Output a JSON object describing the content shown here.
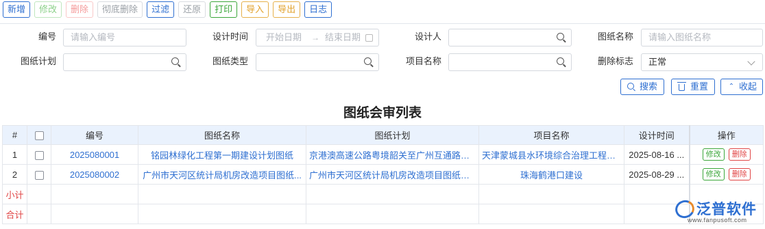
{
  "toolbar": {
    "buttons": [
      {
        "label": "新增",
        "style": "blue"
      },
      {
        "label": "修改",
        "style": "green-dis"
      },
      {
        "label": "删除",
        "style": "red-dis"
      },
      {
        "label": "彻底删除",
        "style": "gray-dis"
      },
      {
        "label": "过滤",
        "style": "blue"
      },
      {
        "label": "还原",
        "style": "gray-dis"
      },
      {
        "label": "打印",
        "style": "green"
      },
      {
        "label": "导入",
        "style": "orange"
      },
      {
        "label": "导出",
        "style": "orange"
      },
      {
        "label": "日志",
        "style": "blue"
      }
    ]
  },
  "filters": {
    "code": {
      "label": "编号",
      "placeholder": "请输入编号"
    },
    "design_time": {
      "label": "设计时间",
      "start_placeholder": "开始日期",
      "separator": "→",
      "end_placeholder": "结束日期"
    },
    "designer": {
      "label": "设计人",
      "value": ""
    },
    "drawing_name": {
      "label": "图纸名称",
      "placeholder": "请输入图纸名称"
    },
    "drawing_plan": {
      "label": "图纸计划",
      "value": ""
    },
    "drawing_type": {
      "label": "图纸类型",
      "value": ""
    },
    "project_name": {
      "label": "项目名称",
      "value": ""
    },
    "delete_flag": {
      "label": "删除标志",
      "value": "正常"
    }
  },
  "actions": {
    "search": "搜索",
    "reset": "重置",
    "collapse": "收起"
  },
  "table_title": "图纸会审列表",
  "table": {
    "columns": [
      "#",
      "",
      "编号",
      "图纸名称",
      "图纸计划",
      "项目名称",
      "设计时间",
      "操作"
    ],
    "rows": [
      {
        "idx": "1",
        "code": "2025080001",
        "drawing_name": "铭园林绿化工程第一期建设计划图纸",
        "drawing_plan": "京港澳高速公路粤境韶关至广州互通路面...",
        "project": "天津蒙城县水环境综合治理工程设...",
        "date": "2025-08-16 ...",
        "edit": "修改",
        "delete": "删除"
      },
      {
        "idx": "2",
        "code": "2025080002",
        "drawing_name": "广州市天河区统计局机房改造项目图纸...",
        "drawing_plan": "广州市天河区统计局机房改造项目图纸计划",
        "project": "珠海鹤港口建设",
        "date": "2025-08-29 ...",
        "edit": "修改",
        "delete": "删除"
      }
    ],
    "subtotal_label": "小计",
    "total_label": "合计"
  },
  "watermark": {
    "name": "泛普软件",
    "url": "www.fanpusoft.com"
  }
}
